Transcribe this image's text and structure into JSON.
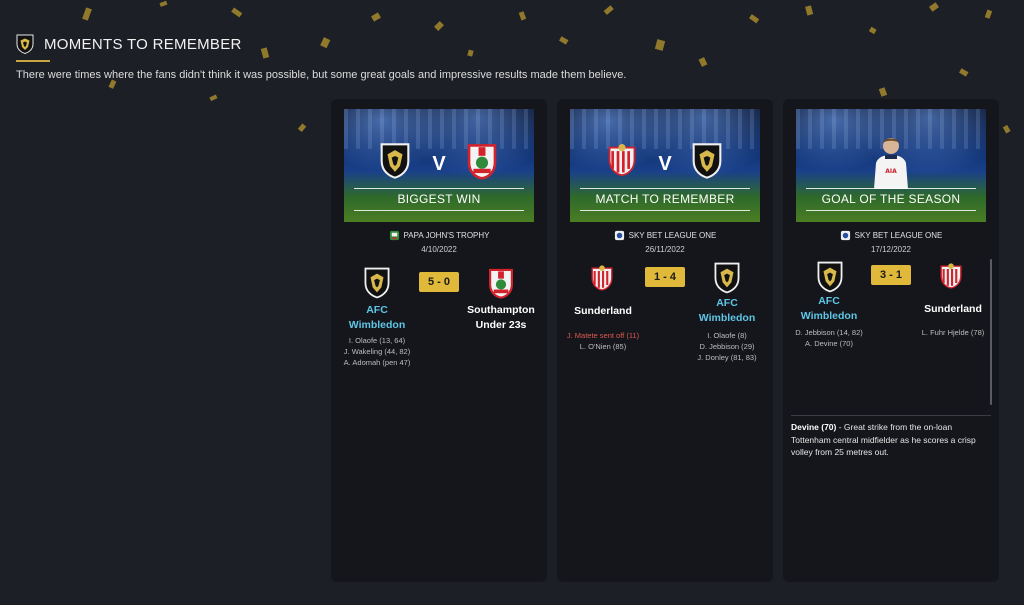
{
  "header": {
    "title": "MOMENTS TO REMEMBER",
    "subtitle": "There were times where the fans didn't think it was possible, but some great goals and impressive results made them believe."
  },
  "cards": [
    {
      "banner_label": "BIGGEST WIN",
      "vs": "V",
      "competition": "PAPA JOHN'S TROPHY",
      "date": "4/10/2022",
      "score": "5 - 0",
      "home_team": [
        "AFC",
        "Wimbledon"
      ],
      "away_team": [
        "Southampton",
        "Under 23s"
      ],
      "home_scorers": [
        "I. Olaofe (13, 64)",
        "J. Wakeling (44, 82)",
        "A. Adomah (pen 47)"
      ],
      "away_scorers": []
    },
    {
      "banner_label": "MATCH TO REMEMBER",
      "vs": "V",
      "competition": "SKY BET LEAGUE ONE",
      "date": "26/11/2022",
      "score": "1 - 4",
      "home_team": [
        "Sunderland"
      ],
      "away_team": [
        "AFC",
        "Wimbledon"
      ],
      "home_events": [
        "J. Matete sent off (11)"
      ],
      "home_scorers": [
        "L. O'Nien (85)"
      ],
      "away_scorers": [
        "I. Olaofe (8)",
        "D. Jebbison (29)",
        "J. Donley (81, 83)"
      ]
    },
    {
      "banner_label": "GOAL OF THE SEASON",
      "competition": "SKY BET LEAGUE ONE",
      "date": "17/12/2022",
      "score": "3 - 1",
      "home_team": [
        "AFC",
        "Wimbledon"
      ],
      "away_team": [
        "Sunderland"
      ],
      "home_scorers": [
        "D. Jebbison (14, 82)",
        "A. Devine (70)"
      ],
      "away_scorers": [
        "L. Fuhr Hjelde (78)"
      ],
      "description_highlight": "Devine (70)",
      "description_text": " - Great strike from the on-loan Tottenham central midfielder as he scores a crisp volley from 25 metres out.",
      "player_shirt_text": "AIA"
    }
  ],
  "colors": {
    "accent_gold": "#e0b83a",
    "team_blue": "#5fc6e6",
    "red_event": "#e0594e"
  }
}
